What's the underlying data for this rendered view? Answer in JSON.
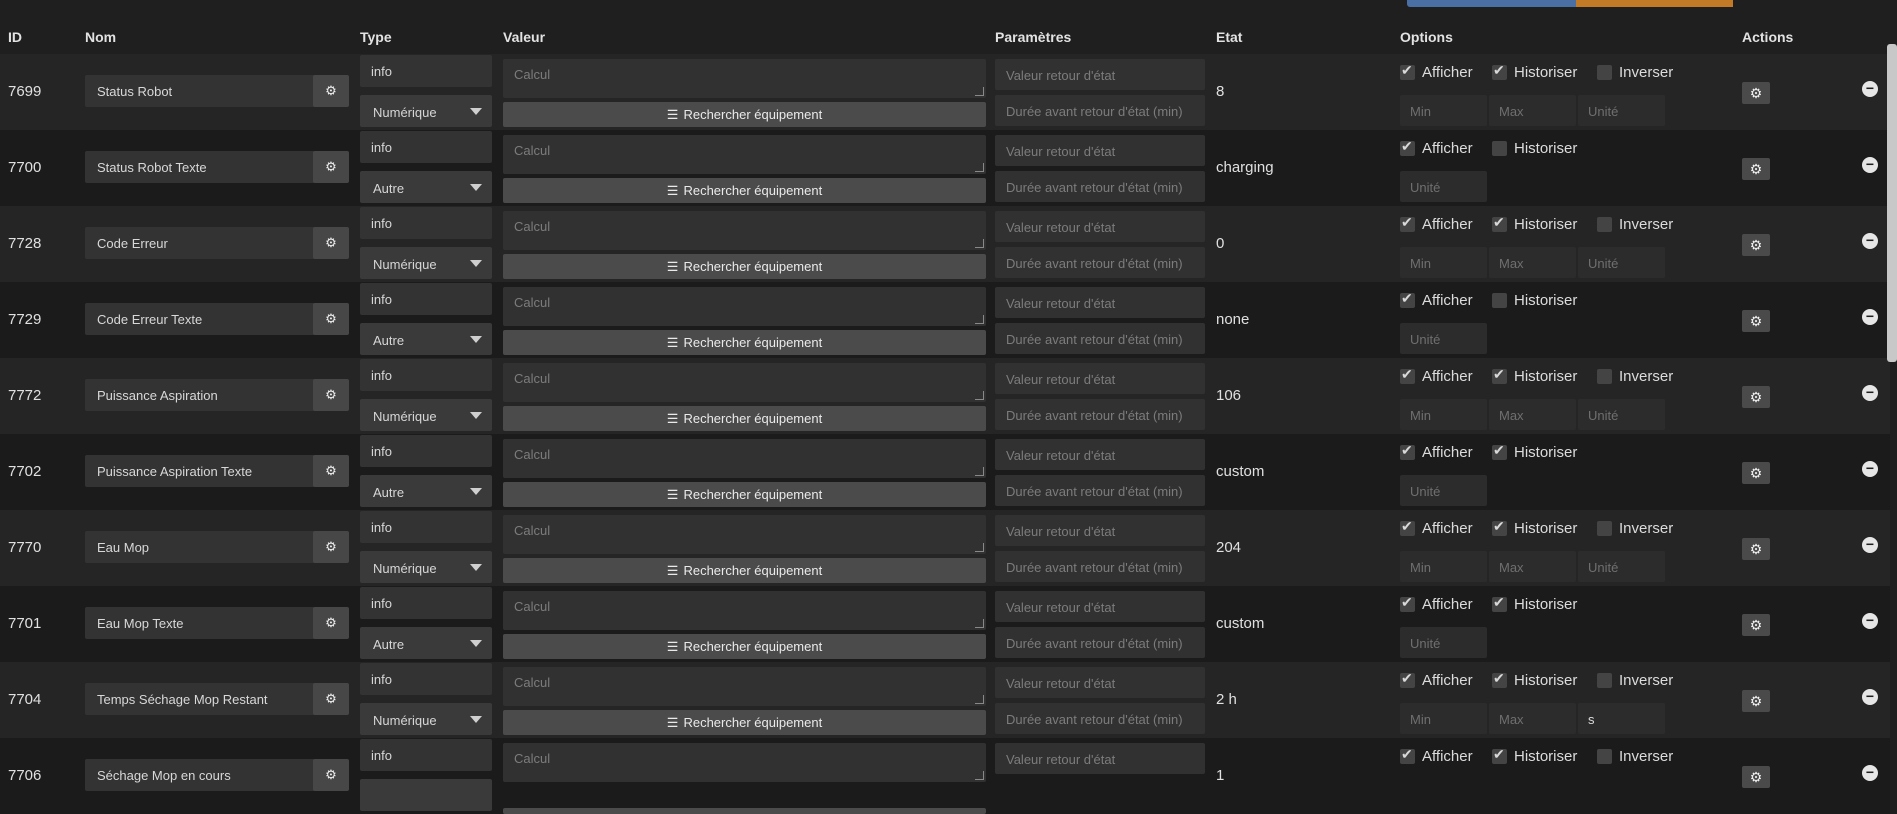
{
  "headers": {
    "id": "ID",
    "nom": "Nom",
    "type": "Type",
    "valeur": "Valeur",
    "parametres": "Paramètres",
    "etat": "Etat",
    "options": "Options",
    "actions": "Actions"
  },
  "labels": {
    "calc_placeholder": "Calcul",
    "rechercher": "Rechercher équipement",
    "valeur_retour": "Valeur retour d'état",
    "duree_retour": "Durée avant retour d'état (min)",
    "afficher": "Afficher",
    "historiser": "Historiser",
    "inverser": "Inverser",
    "min": "Min",
    "max": "Max",
    "unite": "Unité"
  },
  "rows": [
    {
      "id": "7699",
      "name": "Status Robot",
      "type": "info",
      "subtype": "Numérique",
      "etat": "8",
      "afficher": true,
      "historiser": true,
      "show_inverser": true,
      "inverser": false,
      "numeric": true,
      "unit": ""
    },
    {
      "id": "7700",
      "name": "Status Robot Texte",
      "type": "info",
      "subtype": "Autre",
      "etat": "charging",
      "afficher": true,
      "historiser": false,
      "show_inverser": false,
      "inverser": false,
      "numeric": false,
      "unit": ""
    },
    {
      "id": "7728",
      "name": "Code Erreur",
      "type": "info",
      "subtype": "Numérique",
      "etat": "0",
      "afficher": true,
      "historiser": true,
      "show_inverser": true,
      "inverser": false,
      "numeric": true,
      "unit": ""
    },
    {
      "id": "7729",
      "name": "Code Erreur Texte",
      "type": "info",
      "subtype": "Autre",
      "etat": "none",
      "afficher": true,
      "historiser": false,
      "show_inverser": false,
      "inverser": false,
      "numeric": false,
      "unit": ""
    },
    {
      "id": "7772",
      "name": "Puissance Aspiration",
      "type": "info",
      "subtype": "Numérique",
      "etat": "106",
      "afficher": true,
      "historiser": true,
      "show_inverser": true,
      "inverser": false,
      "numeric": true,
      "unit": ""
    },
    {
      "id": "7702",
      "name": "Puissance Aspiration Texte",
      "type": "info",
      "subtype": "Autre",
      "etat": "custom",
      "afficher": true,
      "historiser": true,
      "show_inverser": false,
      "inverser": false,
      "numeric": false,
      "unit": ""
    },
    {
      "id": "7770",
      "name": "Eau Mop",
      "type": "info",
      "subtype": "Numérique",
      "etat": "204",
      "afficher": true,
      "historiser": true,
      "show_inverser": true,
      "inverser": false,
      "numeric": true,
      "unit": ""
    },
    {
      "id": "7701",
      "name": "Eau Mop Texte",
      "type": "info",
      "subtype": "Autre",
      "etat": "custom",
      "afficher": true,
      "historiser": true,
      "show_inverser": false,
      "inverser": false,
      "numeric": false,
      "unit": ""
    },
    {
      "id": "7704",
      "name": "Temps Séchage Mop Restant",
      "type": "info",
      "subtype": "Numérique",
      "etat": "2 h",
      "afficher": true,
      "historiser": true,
      "show_inverser": true,
      "inverser": false,
      "numeric": true,
      "unit": "s"
    },
    {
      "id": "7706",
      "name": "Séchage Mop en cours",
      "type": "info",
      "subtype": "",
      "etat": "1",
      "afficher": true,
      "historiser": true,
      "show_inverser": true,
      "inverser": false,
      "numeric": true,
      "unit": ""
    }
  ]
}
